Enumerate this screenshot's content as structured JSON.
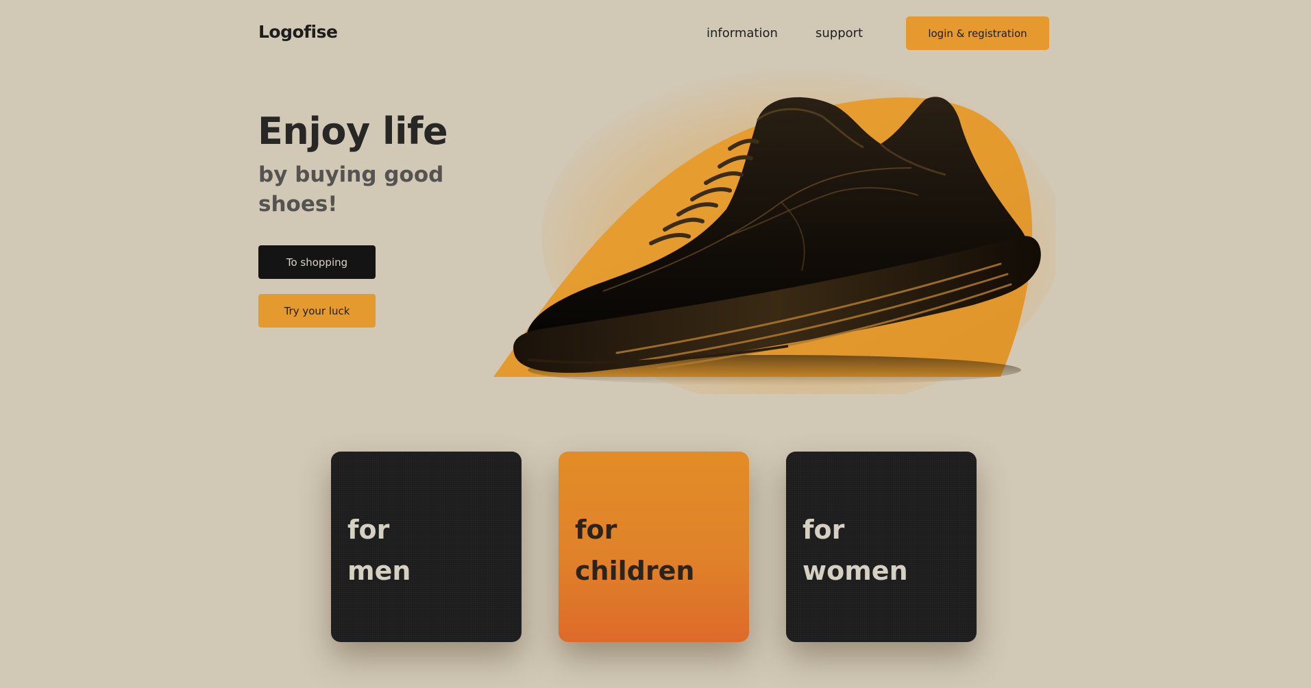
{
  "header": {
    "logo": "Logofise",
    "nav": {
      "information": "information",
      "support": "support"
    },
    "login_label": "login & registration"
  },
  "hero": {
    "title": "Enjoy life",
    "subtitle": "by buying good shoes!",
    "primary_button": "To shopping",
    "secondary_button": "Try your luck",
    "image": "shoe-illustration"
  },
  "categories": [
    {
      "line1": "for",
      "line2": "men"
    },
    {
      "line1": "for",
      "line2": "children"
    },
    {
      "line1": "for",
      "line2": "women"
    }
  ],
  "colors": {
    "background": "#d1c8b6",
    "accent": "#e5992e",
    "dark": "#141414",
    "card_dark": "#1c1c1c",
    "card_orange": "#e0822a"
  }
}
